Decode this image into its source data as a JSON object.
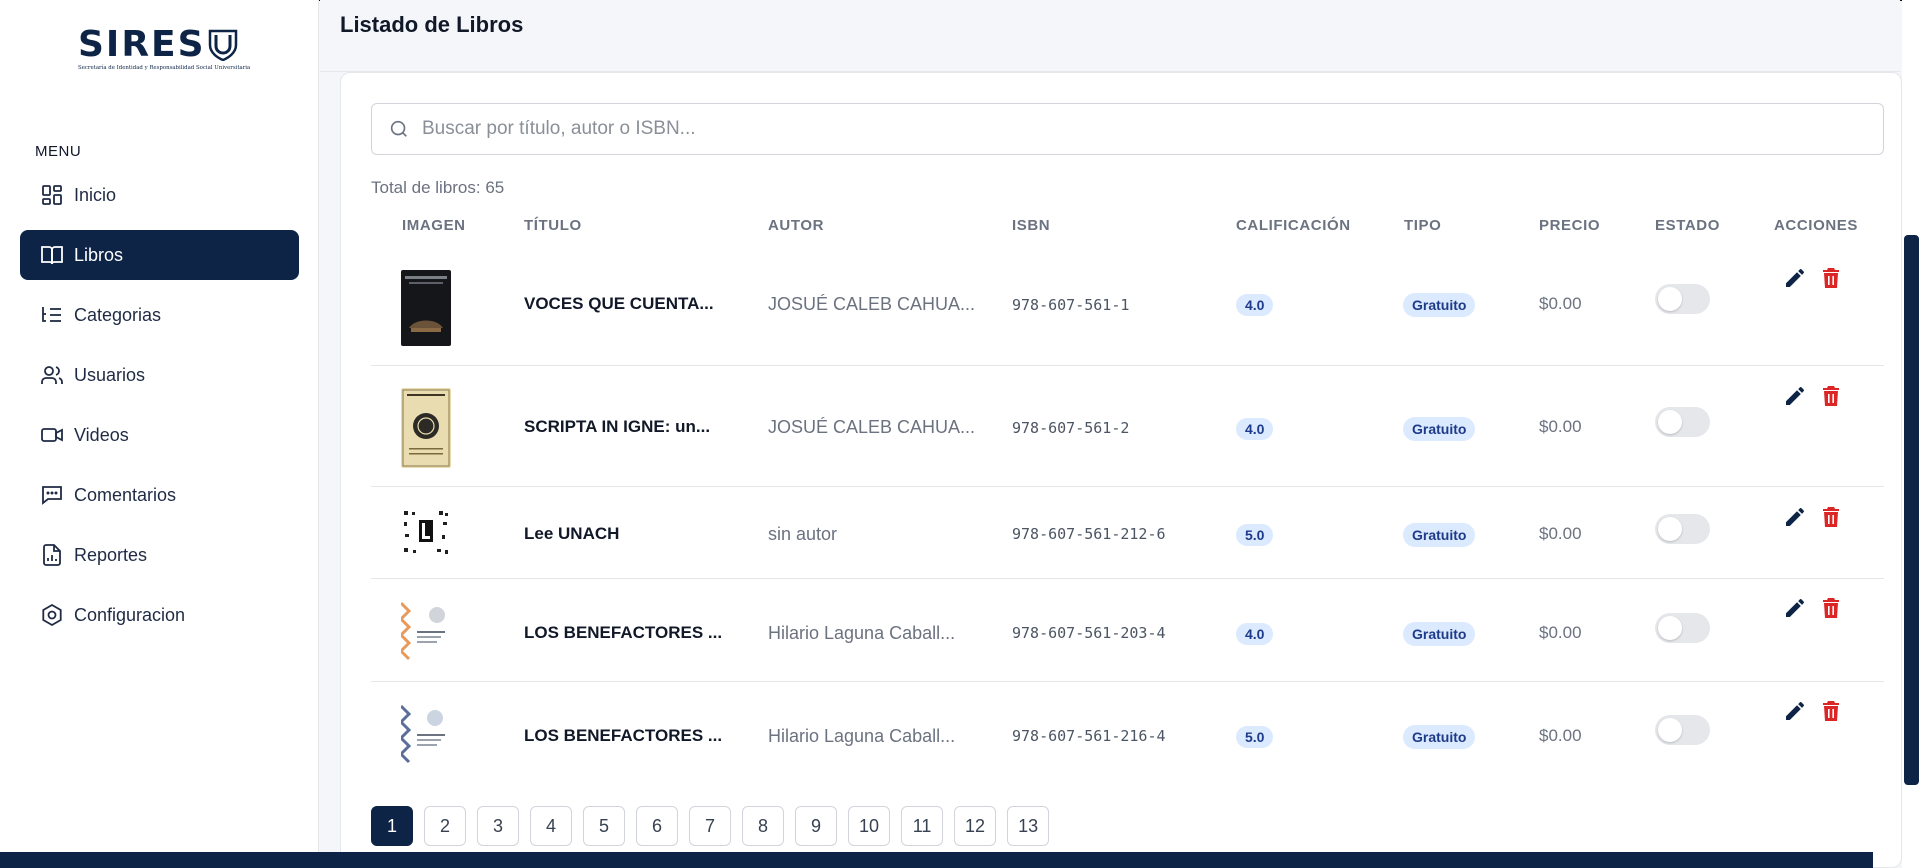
{
  "brand": {
    "logo_text": "SIRES",
    "logo_subtitle": "Secretaría de Identidad y Responsabilidad Social Universitaria",
    "navy": "#0d2447"
  },
  "sidebar": {
    "menu_title": "MENU",
    "items": [
      {
        "label": "Inicio",
        "icon": "dashboard-icon"
      },
      {
        "label": "Libros",
        "icon": "book-open-icon",
        "active": true
      },
      {
        "label": "Categorias",
        "icon": "list-tree-icon"
      },
      {
        "label": "Usuarios",
        "icon": "users-icon"
      },
      {
        "label": "Videos",
        "icon": "video-icon"
      },
      {
        "label": "Comentarios",
        "icon": "message-icon"
      },
      {
        "label": "Reportes",
        "icon": "report-icon"
      },
      {
        "label": "Configuracion",
        "icon": "settings-icon"
      }
    ]
  },
  "page": {
    "title": "Listado de Libros",
    "search_placeholder": "Buscar por título, autor o ISBN...",
    "total_label": "Total de libros: 65"
  },
  "table": {
    "headers": [
      "IMAGEN",
      "TÍTULO",
      "AUTOR",
      "ISBN",
      "CALIFICACIÓN",
      "TIPO",
      "PRECIO",
      "ESTADO",
      "ACCIONES"
    ],
    "rows": [
      {
        "title": "VOCES QUE CUENTA...",
        "author": "JOSUÉ CALEB CAHUA...",
        "isbn": "978-607-561-1",
        "rating": "4.0",
        "type": "Gratuito",
        "price": "$0.00",
        "active": false
      },
      {
        "title": "SCRIPTA IN IGNE: un...",
        "author": "JOSUÉ CALEB CAHUA...",
        "isbn": "978-607-561-2",
        "rating": "4.0",
        "type": "Gratuito",
        "price": "$0.00",
        "active": false
      },
      {
        "title": "Lee UNACH",
        "author": "sin autor",
        "isbn": "978-607-561-212-6",
        "rating": "5.0",
        "type": "Gratuito",
        "price": "$0.00",
        "active": false
      },
      {
        "title": "LOS BENEFACTORES ...",
        "author": "Hilario Laguna Caball...",
        "isbn": "978-607-561-203-4",
        "rating": "4.0",
        "type": "Gratuito",
        "price": "$0.00",
        "active": false
      },
      {
        "title": "LOS BENEFACTORES ...",
        "author": "Hilario Laguna Caball...",
        "isbn": "978-607-561-216-4",
        "rating": "5.0",
        "type": "Gratuito",
        "price": "$0.00",
        "active": false
      }
    ]
  },
  "pagination": {
    "pages": [
      "1",
      "2",
      "3",
      "4",
      "5",
      "6",
      "7",
      "8",
      "9",
      "10",
      "11",
      "12",
      "13"
    ],
    "current": "1"
  }
}
